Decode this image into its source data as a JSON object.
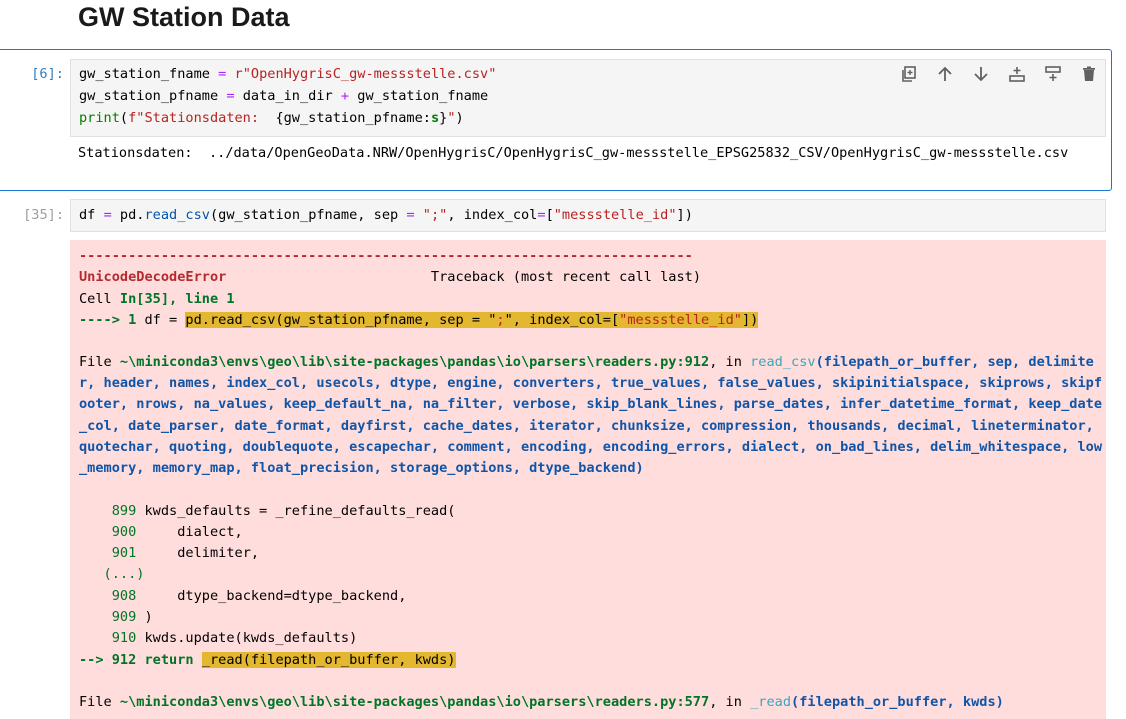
{
  "page_title": "GW Station Data",
  "cell6": {
    "prompt": "[6]:",
    "line1": {
      "a": "gw_station_fname ",
      "eq": "=",
      "b": " r",
      "s": "\"OpenHygrisC_gw-messstelle.csv\""
    },
    "line2": {
      "a": "gw_station_pfname ",
      "eq": "=",
      "b": " data_in_dir ",
      "plus": "+",
      "c": " gw_station_fname"
    },
    "line3": {
      "fn": "print",
      "a": "(",
      "s1": "f\"Stationsdaten:  ",
      "i": "{gw_station_pfname:",
      "fmt": "s",
      "i2": "}",
      "s2": "\"",
      "b": ")"
    },
    "output": "Stationsdaten:  ../data/OpenGeoData.NRW/OpenHygrisC/OpenHygrisC_gw-messstelle_EPSG25832_CSV/OpenHygrisC_gw-messstelle.csv"
  },
  "toolbar": {
    "copy": "copy-icon",
    "up": "arrow-up-icon",
    "down": "arrow-down-icon",
    "insert_above": "insert-above-icon",
    "insert_below": "insert-below-icon",
    "delete": "trash-icon"
  },
  "cell35": {
    "prompt": "[35]:",
    "code": {
      "a": "df ",
      "eq": "=",
      "b": " pd.",
      "fn": "read_csv",
      "c": "(gw_station_pfname, sep ",
      "eq2": "=",
      "d": " ",
      "s1": "\";\"",
      "e": ", index_col",
      "eq3": "=",
      "f": "[",
      "s2": "\"messstelle_id\"",
      "g": "])"
    }
  },
  "error": {
    "dashes": "---------------------------------------------------------------------------",
    "name": "UnicodeDecodeError",
    "traceback": "                         Traceback (most recent call last)",
    "cell_line": {
      "a": "Cell ",
      "b": "In[35], line 1"
    },
    "arrow1": {
      "arrow": "----> 1 ",
      "pre": "df = ",
      "hl_a": "pd.read_csv(gw_station_pfname, sep = \"",
      "hl_s": ";",
      "hl_b": "\", index_col=[",
      "hl_s2": "\"messstelle_id\"",
      "hl_c": "])"
    },
    "file1": {
      "a": "File ",
      "path": "~\\miniconda3\\envs\\geo\\lib\\site-packages\\pandas\\io\\parsers\\readers.py:912",
      "b": ", in ",
      "fn": "read_csv",
      "sig": "(filepath_or_buffer, sep, delimiter, header, names, index_col, usecols, dtype, engine, converters, true_values, false_values, skipinitialspace, skiprows, skipfooter, nrows, na_values, keep_default_na, na_filter, verbose, skip_blank_lines, parse_dates, infer_datetime_format, keep_date_col, date_parser, date_format, dayfirst, cache_dates, iterator, chunksize, compression, thousands, decimal, lineterminator, quotechar, quoting, doublequote, escapechar, comment, encoding, encoding_errors, dialect, on_bad_lines, delim_whitespace, low_memory, memory_map, float_precision, storage_options, dtype_backend)"
    },
    "src": [
      {
        "n": "    899 ",
        "t": "kwds_defaults = _refine_defaults_read("
      },
      {
        "n": "    900 ",
        "t": "    dialect,"
      },
      {
        "n": "    901 ",
        "t": "    delimiter,"
      },
      {
        "n": "   (...)",
        "t": ""
      },
      {
        "n": "    908 ",
        "t": "    dtype_backend=dtype_backend,"
      },
      {
        "n": "    909 ",
        "t": ")"
      },
      {
        "n": "    910 ",
        "t": "kwds.update(kwds_defaults)"
      }
    ],
    "arrow2": {
      "arrow": "--> 912 ",
      "kw": "return",
      "sp": " ",
      "hl": "_read(filepath_or_buffer, kwds)"
    },
    "file2": {
      "a": "File ",
      "path": "~\\miniconda3\\envs\\geo\\lib\\site-packages\\pandas\\io\\parsers\\readers.py:577",
      "b": ", in ",
      "fn": "_read",
      "sig": "(filepath_or_buffer, kwds)"
    }
  }
}
